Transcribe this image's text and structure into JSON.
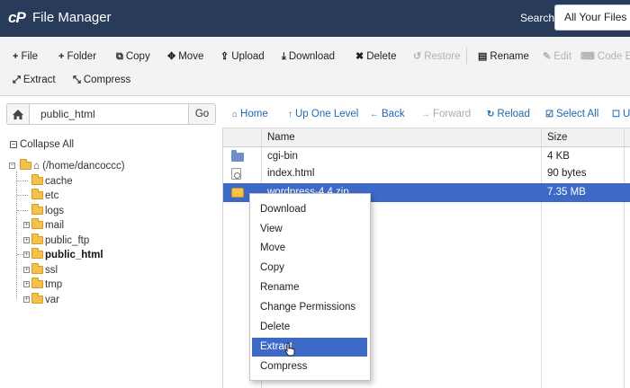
{
  "header": {
    "app_title": "File Manager",
    "search_label": "Search",
    "search_scope": "All Your Files",
    "colors": {
      "bar": "#283b5a",
      "accent": "#3d6ac7",
      "link": "#1f69b2"
    }
  },
  "toolbar": {
    "file": "File",
    "folder": "Folder",
    "copy": "Copy",
    "move": "Move",
    "upload": "Upload",
    "download": "Download",
    "delete": "Delete",
    "restore": "Restore",
    "rename": "Rename",
    "edit": "Edit",
    "code_editor": "Code E",
    "extract": "Extract",
    "compress": "Compress"
  },
  "pathbar": {
    "path": "public_html",
    "go": "Go"
  },
  "nav": {
    "home": "Home",
    "up": "Up One Level",
    "back": "Back",
    "forward": "Forward",
    "reload": "Reload",
    "select_all": "Select All",
    "unselect": "U"
  },
  "tree": {
    "collapse_all": "Collapse All",
    "root": "(/home/dancoccc)",
    "items": [
      "cache",
      "etc",
      "logs",
      "mail",
      "public_ftp",
      "public_html",
      "ssl",
      "tmp",
      "var"
    ]
  },
  "table": {
    "headers": {
      "name": "Name",
      "size": "Size"
    },
    "rows": [
      {
        "icon": "folder-icon",
        "name": "cgi-bin",
        "size": "4 KB"
      },
      {
        "icon": "html-file-icon",
        "name": "index.html",
        "size": "90 bytes"
      },
      {
        "icon": "zip-file-icon",
        "name": "wordpress-4.4.zip",
        "size": "7.35 MB"
      }
    ]
  },
  "context_menu": {
    "items": [
      "Download",
      "View",
      "Move",
      "Copy",
      "Rename",
      "Change Permissions",
      "Delete",
      "Extract",
      "Compress"
    ],
    "highlighted": "Extract"
  }
}
